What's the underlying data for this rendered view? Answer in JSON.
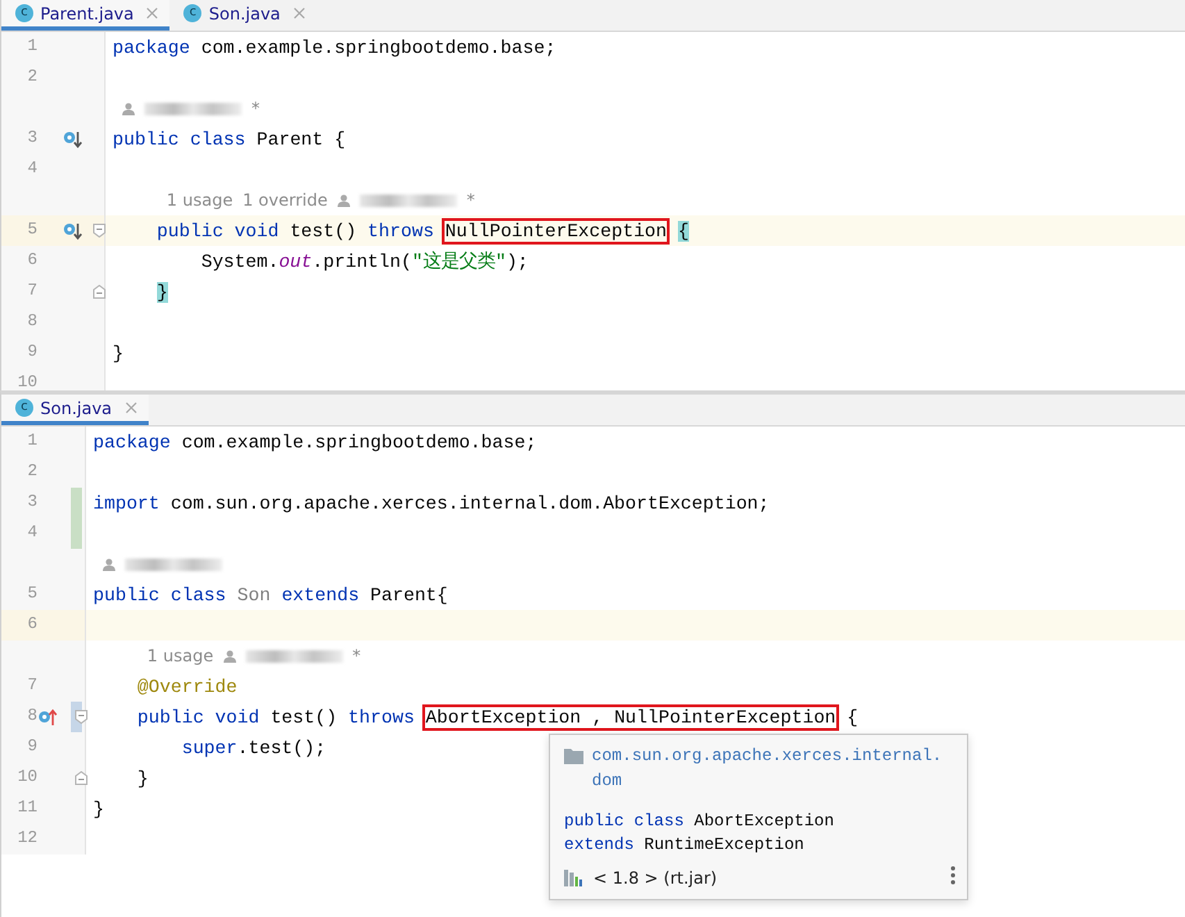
{
  "editors": [
    {
      "tabs": [
        {
          "label": "Parent.java",
          "icon_letter": "c",
          "selected": true
        },
        {
          "label": "Son.java",
          "icon_letter": "c",
          "selected": false
        }
      ],
      "lines": [
        {
          "kind": "code",
          "number": "1",
          "segments": [
            {
              "text": "package",
              "kind": "keyword"
            },
            {
              "text": " com.example.springbootdemo.base;",
              "kind": "plain"
            }
          ]
        },
        {
          "kind": "code",
          "number": "2"
        },
        {
          "kind": "inlay",
          "author_redacted": true,
          "author_mark": "*"
        },
        {
          "kind": "code",
          "number": "3",
          "implemented": true,
          "segments": [
            {
              "text": "public class",
              "kind": "keyword"
            },
            {
              "text": " Parent {",
              "kind": "plain"
            }
          ]
        },
        {
          "kind": "code",
          "number": "4"
        },
        {
          "kind": "inlay",
          "hints": [
            "1 usage",
            "1 override"
          ],
          "author_redacted": true,
          "author_mark": "*"
        },
        {
          "kind": "code",
          "number": "5",
          "implemented": true,
          "fold_start": true,
          "current": true,
          "segments": [
            {
              "text": "    public void",
              "kind": "keyword"
            },
            {
              "text": " test() ",
              "kind": "plain"
            },
            {
              "text": "throws",
              "kind": "keyword"
            },
            {
              "text": " NullPointerException",
              "kind": "plain",
              "boxed": true
            },
            {
              "text": " {",
              "kind": "plain",
              "matched": true
            }
          ]
        },
        {
          "kind": "code",
          "number": "6",
          "segments": [
            {
              "text": "        System.",
              "kind": "plain"
            },
            {
              "text": "out",
              "kind": "field"
            },
            {
              "text": ".println(",
              "kind": "plain"
            },
            {
              "text": "\"这是父类\"",
              "kind": "string"
            },
            {
              "text": ");",
              "kind": "plain"
            }
          ]
        },
        {
          "kind": "code",
          "number": "7",
          "fold_end": true,
          "segments": [
            {
              "text": "    }",
              "kind": "plain",
              "matched": true
            }
          ]
        },
        {
          "kind": "code",
          "number": "8"
        },
        {
          "kind": "code",
          "number": "9",
          "segments": [
            {
              "text": "}",
              "kind": "plain"
            }
          ]
        },
        {
          "kind": "code",
          "number": "10"
        }
      ]
    },
    {
      "tabs": [
        {
          "label": "Son.java",
          "icon_letter": "c",
          "selected": true
        }
      ],
      "lines": [
        {
          "kind": "code",
          "number": "1",
          "segments": [
            {
              "text": "package",
              "kind": "keyword"
            },
            {
              "text": " com.example.springbootdemo.base;",
              "kind": "plain"
            }
          ]
        },
        {
          "kind": "code",
          "number": "2"
        },
        {
          "kind": "code",
          "number": "3",
          "changed": true,
          "segments": [
            {
              "text": "import",
              "kind": "keyword"
            },
            {
              "text": " com.sun.org.apache.xerces.internal.dom.AbortException;",
              "kind": "plain"
            }
          ]
        },
        {
          "kind": "code",
          "number": "4",
          "changed": true
        },
        {
          "kind": "inlay",
          "author_redacted": true
        },
        {
          "kind": "code",
          "number": "5",
          "segments": [
            {
              "text": "public class",
              "kind": "keyword"
            },
            {
              "text": " Son",
              "kind": "unused"
            },
            {
              "text": " extends",
              "kind": "keyword"
            },
            {
              "text": " Parent{",
              "kind": "plain"
            }
          ]
        },
        {
          "kind": "code",
          "number": "6",
          "current": true
        },
        {
          "kind": "inlay",
          "hints": [
            "1 usage"
          ],
          "author_redacted": true,
          "author_mark": "*"
        },
        {
          "kind": "code",
          "number": "7",
          "segments": [
            {
              "text": "    @Override",
              "kind": "annotation"
            }
          ]
        },
        {
          "kind": "code",
          "number": "8",
          "overrides": true,
          "fold_start": true,
          "modified": true,
          "segments": [
            {
              "text": "    public void",
              "kind": "keyword"
            },
            {
              "text": " test() ",
              "kind": "plain"
            },
            {
              "text": "throws",
              "kind": "keyword"
            },
            {
              "text": " AbortException , NullPointerException",
              "kind": "plain",
              "boxed": true
            },
            {
              "text": " {",
              "kind": "plain"
            }
          ]
        },
        {
          "kind": "code",
          "number": "9",
          "segments": [
            {
              "text": "        super",
              "kind": "keyword"
            },
            {
              "text": ".test();",
              "kind": "plain"
            }
          ]
        },
        {
          "kind": "code",
          "number": "10",
          "fold_end": true,
          "segments": [
            {
              "text": "    }",
              "kind": "plain"
            }
          ]
        },
        {
          "kind": "code",
          "number": "11",
          "segments": [
            {
              "text": "}",
              "kind": "plain"
            }
          ]
        },
        {
          "kind": "code",
          "number": "12"
        }
      ],
      "popup": {
        "package": "com.sun.org.apache.xerces.internal.dom",
        "declaration": [
          [
            {
              "text": "public class",
              "kind": "keyword"
            },
            {
              "text": " AbortException",
              "kind": "plain"
            }
          ],
          [
            {
              "text": "extends",
              "kind": "keyword"
            },
            {
              "text": " RuntimeException",
              "kind": "plain"
            }
          ]
        ],
        "library": "< 1.8 > (rt.jar)"
      }
    }
  ]
}
